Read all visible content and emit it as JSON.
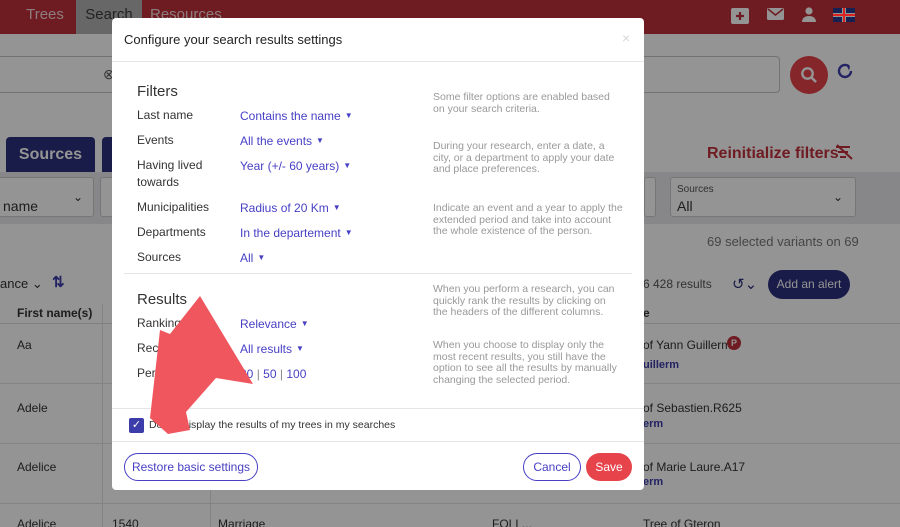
{
  "topbar": {
    "tabs": [
      "Trees",
      "Search",
      "Resources"
    ],
    "icons": [
      "add-tree-icon",
      "mail-icon",
      "user-icon",
      "uk-flag-icon"
    ]
  },
  "background": {
    "tabs": [
      "Sources"
    ],
    "reinitialize": "Reinitialize filters",
    "filters": [
      {
        "label": "",
        "value": "name"
      },
      {
        "label": "Sources",
        "value": "All"
      }
    ],
    "variants": "69 selected variants on 69",
    "sort": "ance",
    "results_count": "6 428 results",
    "add_alert": "Add an alert",
    "columns": [
      "First name(s)",
      "e"
    ],
    "rows": [
      {
        "first": "Aa",
        "tree": "of Yann Guillerm",
        "owner": "uillerm",
        "badge": "P"
      },
      {
        "first": "Adele",
        "tree": "of Sebastien.R625",
        "owner": "erm"
      },
      {
        "first": "Adelice",
        "tree": "of Marie Laure.A17",
        "owner": "erm"
      },
      {
        "first": "Adelice",
        "year": "1540",
        "event": "Marriage",
        "place": "FOLL...",
        "tree": "Tree of Gteron"
      }
    ]
  },
  "modal": {
    "title": "Configure your search results settings",
    "close": "×",
    "filters_title": "Filters",
    "filters": [
      {
        "label": "Last name",
        "value": "Contains the name"
      },
      {
        "label": "Events",
        "value": "All the events"
      },
      {
        "label": "Having lived towards",
        "value": "Year (+/- 60 years)"
      },
      {
        "label": "Municipalities",
        "value": "Radius of 20 Km"
      },
      {
        "label": "Departments",
        "value": "In the departement"
      },
      {
        "label": "Sources",
        "value": "All"
      }
    ],
    "help": [
      "Some filter options are enabled based on your search criteria.",
      "During your research, enter a date, a city, or a department to apply your date and place preferences.",
      "Indicate an event and a year to apply the extended period and take into account the whole existence of the person.",
      "When you perform a research, you can quickly rank the results by clicking on the headers of the different columns.",
      "When you choose to display only the most recent results, you still have the option to see all the results by manually changing the selected period."
    ],
    "results_title": "Results",
    "results": [
      {
        "label": "Ranking",
        "value": "Relevance"
      },
      {
        "label": "Recency",
        "value": "All results"
      }
    ],
    "per_page_label": "Per page",
    "per_page_options": [
      "20",
      "50",
      "100"
    ],
    "per_page_sep": "|",
    "checkbox_label": "Do not display the results of my trees in my searches",
    "checkbox_checked": true,
    "restore_label": "Restore basic settings",
    "cancel_label": "Cancel",
    "save_label": "Save"
  },
  "colors": {
    "brand": "#c0303c",
    "accent": "#4740c4",
    "navy": "#2b2f7e",
    "save": "#e6434b",
    "annotation": "#f0565d"
  }
}
